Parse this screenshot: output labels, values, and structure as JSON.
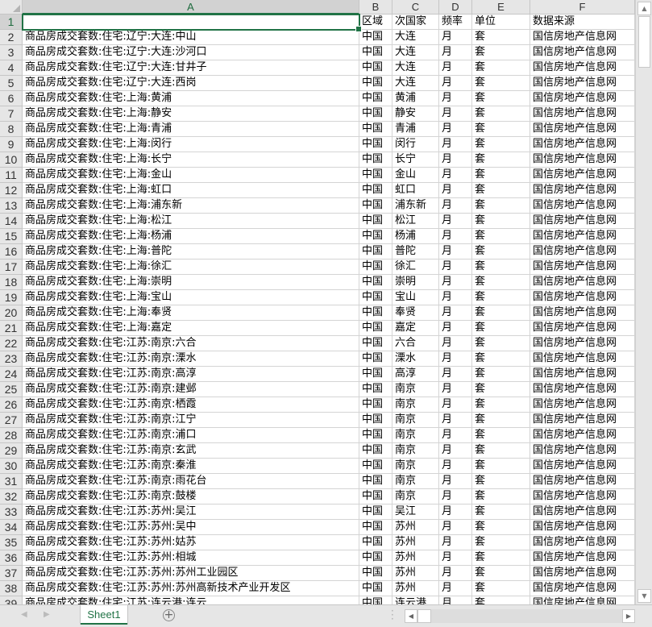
{
  "columns": [
    "A",
    "B",
    "C",
    "D",
    "E",
    "F"
  ],
  "header_row": [
    "",
    "区域",
    "次国家",
    "频率",
    "单位",
    "数据来源"
  ],
  "rows": [
    [
      "商品房成交套数:住宅:辽宁:大连:中山",
      "中国",
      "大连",
      "月",
      "套",
      "国信房地产信息网"
    ],
    [
      "商品房成交套数:住宅:辽宁:大连:沙河口",
      "中国",
      "大连",
      "月",
      "套",
      "国信房地产信息网"
    ],
    [
      "商品房成交套数:住宅:辽宁:大连:甘井子",
      "中国",
      "大连",
      "月",
      "套",
      "国信房地产信息网"
    ],
    [
      "商品房成交套数:住宅:辽宁:大连:西岗",
      "中国",
      "大连",
      "月",
      "套",
      "国信房地产信息网"
    ],
    [
      "商品房成交套数:住宅:上海:黄浦",
      "中国",
      "黄浦",
      "月",
      "套",
      "国信房地产信息网"
    ],
    [
      "商品房成交套数:住宅:上海:静安",
      "中国",
      "静安",
      "月",
      "套",
      "国信房地产信息网"
    ],
    [
      "商品房成交套数:住宅:上海:青浦",
      "中国",
      "青浦",
      "月",
      "套",
      "国信房地产信息网"
    ],
    [
      "商品房成交套数:住宅:上海:闵行",
      "中国",
      "闵行",
      "月",
      "套",
      "国信房地产信息网"
    ],
    [
      "商品房成交套数:住宅:上海:长宁",
      "中国",
      "长宁",
      "月",
      "套",
      "国信房地产信息网"
    ],
    [
      "商品房成交套数:住宅:上海:金山",
      "中国",
      "金山",
      "月",
      "套",
      "国信房地产信息网"
    ],
    [
      "商品房成交套数:住宅:上海:虹口",
      "中国",
      "虹口",
      "月",
      "套",
      "国信房地产信息网"
    ],
    [
      "商品房成交套数:住宅:上海:浦东新",
      "中国",
      "浦东新",
      "月",
      "套",
      "国信房地产信息网"
    ],
    [
      "商品房成交套数:住宅:上海:松江",
      "中国",
      "松江",
      "月",
      "套",
      "国信房地产信息网"
    ],
    [
      "商品房成交套数:住宅:上海:杨浦",
      "中国",
      "杨浦",
      "月",
      "套",
      "国信房地产信息网"
    ],
    [
      "商品房成交套数:住宅:上海:普陀",
      "中国",
      "普陀",
      "月",
      "套",
      "国信房地产信息网"
    ],
    [
      "商品房成交套数:住宅:上海:徐汇",
      "中国",
      "徐汇",
      "月",
      "套",
      "国信房地产信息网"
    ],
    [
      "商品房成交套数:住宅:上海:崇明",
      "中国",
      "崇明",
      "月",
      "套",
      "国信房地产信息网"
    ],
    [
      "商品房成交套数:住宅:上海:宝山",
      "中国",
      "宝山",
      "月",
      "套",
      "国信房地产信息网"
    ],
    [
      "商品房成交套数:住宅:上海:奉贤",
      "中国",
      "奉贤",
      "月",
      "套",
      "国信房地产信息网"
    ],
    [
      "商品房成交套数:住宅:上海:嘉定",
      "中国",
      "嘉定",
      "月",
      "套",
      "国信房地产信息网"
    ],
    [
      "商品房成交套数:住宅:江苏:南京:六合",
      "中国",
      "六合",
      "月",
      "套",
      "国信房地产信息网"
    ],
    [
      "商品房成交套数:住宅:江苏:南京:溧水",
      "中国",
      "溧水",
      "月",
      "套",
      "国信房地产信息网"
    ],
    [
      "商品房成交套数:住宅:江苏:南京:高淳",
      "中国",
      "高淳",
      "月",
      "套",
      "国信房地产信息网"
    ],
    [
      "商品房成交套数:住宅:江苏:南京:建邺",
      "中国",
      "南京",
      "月",
      "套",
      "国信房地产信息网"
    ],
    [
      "商品房成交套数:住宅:江苏:南京:栖霞",
      "中国",
      "南京",
      "月",
      "套",
      "国信房地产信息网"
    ],
    [
      "商品房成交套数:住宅:江苏:南京:江宁",
      "中国",
      "南京",
      "月",
      "套",
      "国信房地产信息网"
    ],
    [
      "商品房成交套数:住宅:江苏:南京:浦口",
      "中国",
      "南京",
      "月",
      "套",
      "国信房地产信息网"
    ],
    [
      "商品房成交套数:住宅:江苏:南京:玄武",
      "中国",
      "南京",
      "月",
      "套",
      "国信房地产信息网"
    ],
    [
      "商品房成交套数:住宅:江苏:南京:秦淮",
      "中国",
      "南京",
      "月",
      "套",
      "国信房地产信息网"
    ],
    [
      "商品房成交套数:住宅:江苏:南京:雨花台",
      "中国",
      "南京",
      "月",
      "套",
      "国信房地产信息网"
    ],
    [
      "商品房成交套数:住宅:江苏:南京:鼓楼",
      "中国",
      "南京",
      "月",
      "套",
      "国信房地产信息网"
    ],
    [
      "商品房成交套数:住宅:江苏:苏州:吴江",
      "中国",
      "吴江",
      "月",
      "套",
      "国信房地产信息网"
    ],
    [
      "商品房成交套数:住宅:江苏:苏州:吴中",
      "中国",
      "苏州",
      "月",
      "套",
      "国信房地产信息网"
    ],
    [
      "商品房成交套数:住宅:江苏:苏州:姑苏",
      "中国",
      "苏州",
      "月",
      "套",
      "国信房地产信息网"
    ],
    [
      "商品房成交套数:住宅:江苏:苏州:相城",
      "中国",
      "苏州",
      "月",
      "套",
      "国信房地产信息网"
    ],
    [
      "商品房成交套数:住宅:江苏:苏州:苏州工业园区",
      "中国",
      "苏州",
      "月",
      "套",
      "国信房地产信息网"
    ],
    [
      "商品房成交套数:住宅:江苏:苏州:苏州高新技术产业开发区",
      "中国",
      "苏州",
      "月",
      "套",
      "国信房地产信息网"
    ],
    [
      "商品房成交套数:住宅:江苏:连云港:连云",
      "中国",
      "连云港",
      "月",
      "套",
      "国信房地产信息网"
    ]
  ],
  "sheet_tabs": [
    "Sheet1"
  ],
  "icons": {
    "add_sheet": "plus-circle-icon",
    "scroll_up": "triangle-up-icon",
    "scroll_down": "triangle-down-icon",
    "scroll_left": "triangle-left-icon",
    "scroll_right": "triangle-right-icon"
  },
  "colors": {
    "accent": "#217346"
  }
}
